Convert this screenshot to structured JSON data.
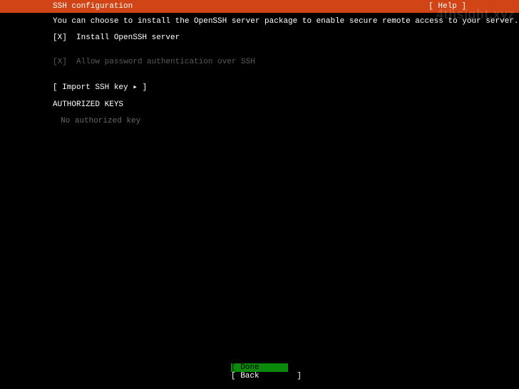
{
  "header": {
    "title": "SSH configuration",
    "help": "[ Help ]"
  },
  "main": {
    "description": "You can choose to install the OpenSSH server package to enable secure remote access to your server.",
    "options": [
      {
        "checkbox": "[X]",
        "label": "Install OpenSSH server",
        "dimmed": false
      },
      {
        "checkbox": "[X]",
        "label": "Allow password authentication over SSH",
        "dimmed": true
      }
    ],
    "import_key": "[ Import SSH key ▸ ]",
    "section_label": "AUTHORIZED KEYS",
    "empty_keys": "No authorized key"
  },
  "footer": {
    "done": "[ Done        ]",
    "back": "[ Back        ]"
  },
  "watermark": "4thsight.xyz"
}
